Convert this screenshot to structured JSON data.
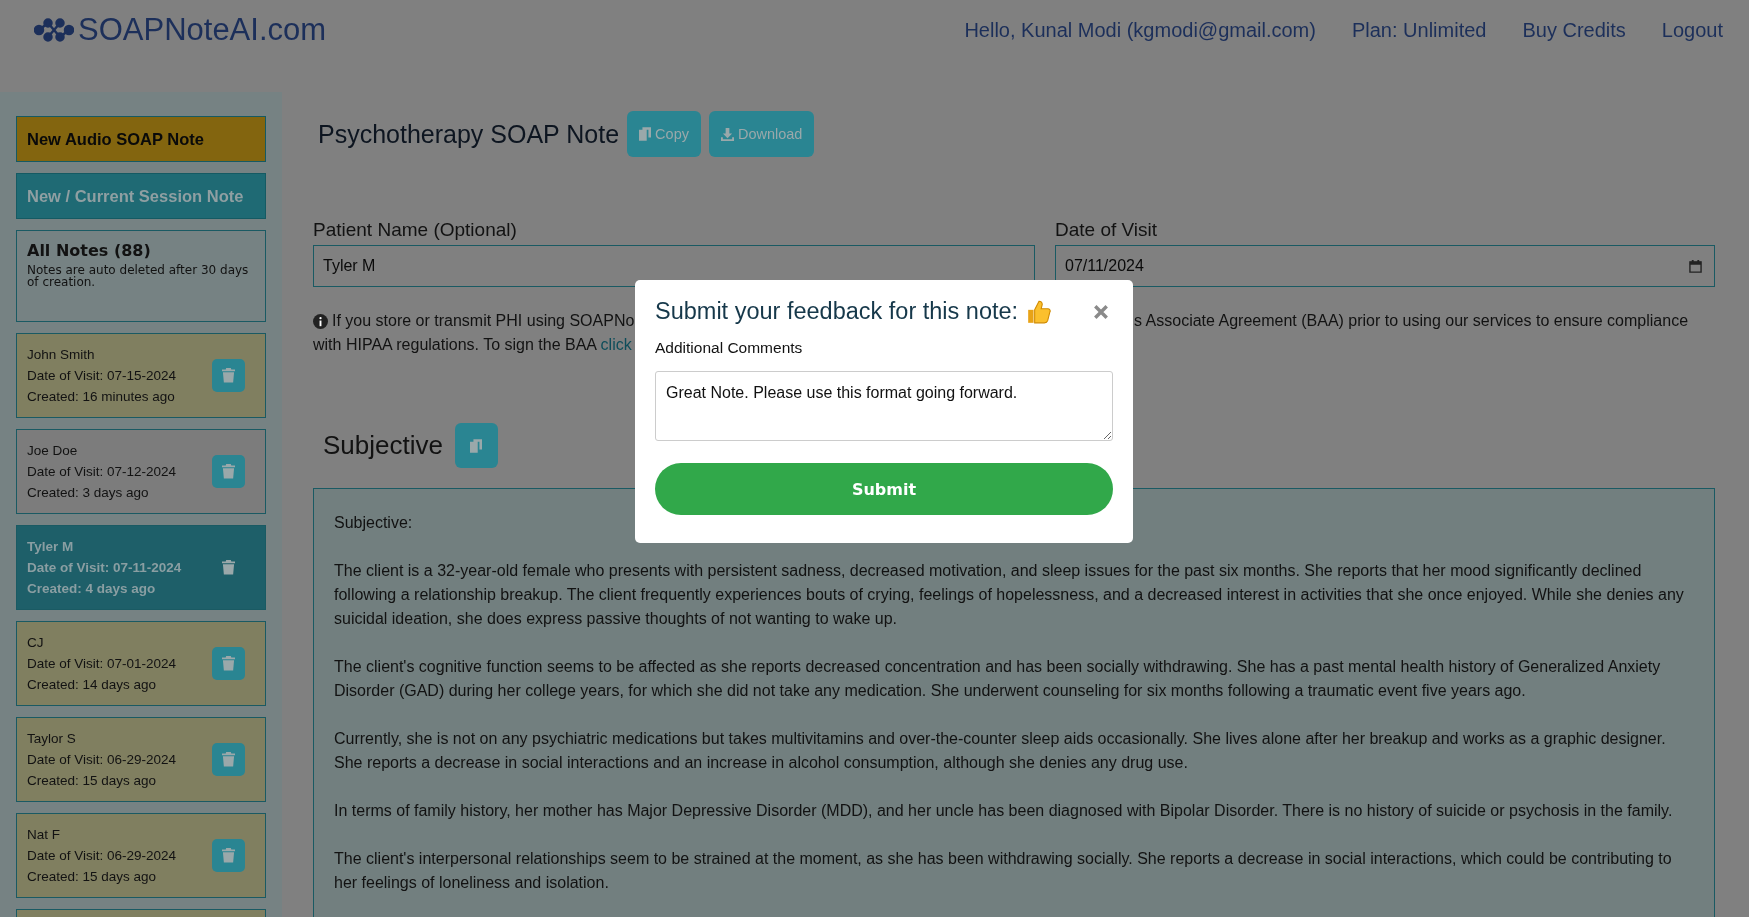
{
  "header": {
    "logo": "SOAPNoteAI.com",
    "nav": [
      {
        "label": "Hello, Kunal Modi (kgmodi@gmail.com)"
      },
      {
        "label": "Plan: Unlimited"
      },
      {
        "label": "Buy Credits"
      },
      {
        "label": "Logout"
      }
    ]
  },
  "sidebar": {
    "new_audio": "New Audio SOAP Note",
    "new_session": "New / Current Session Note",
    "all_notes": {
      "title": "All Notes (88)",
      "hint": "Notes are auto deleted after 30 days of creation."
    },
    "notes": [
      {
        "name": "John Smith",
        "date": "Date of Visit: 07-15-2024",
        "created": "Created: 16 minutes ago",
        "selected": false,
        "color": "#807f60"
      },
      {
        "name": "Joe Doe",
        "date": "Date of Visit: 07-12-2024",
        "created": "Created: 3 days ago",
        "selected": false,
        "color": "#7c7c7c"
      },
      {
        "name": "Tyler M",
        "date": "Date of Visit: 07-11-2024",
        "created": "Created: 4 days ago",
        "selected": true,
        "color": "#1e5f69"
      },
      {
        "name": "CJ",
        "date": "Date of Visit: 07-01-2024",
        "created": "Created: 14 days ago",
        "selected": false,
        "color": "#807f60"
      },
      {
        "name": "Taylor S",
        "date": "Date of Visit: 06-29-2024",
        "created": "Created: 15 days ago",
        "selected": false,
        "color": "#807f60"
      },
      {
        "name": "Nat F",
        "date": "Date of Visit: 06-29-2024",
        "created": "Created: 15 days ago",
        "selected": false,
        "color": "#807f60"
      }
    ]
  },
  "main": {
    "title": "Psychotherapy SOAP Note",
    "copy": "Copy",
    "download": "Download",
    "patient": {
      "label": "Patient Name (Optional)",
      "value": "Tyler M"
    },
    "date": {
      "label": "Date of Visit",
      "value": "07/11/2024"
    },
    "notice": {
      "line1_left": "If you store or transmit PHI using SOAPNo",
      "line1_right": "s Associate Agreement (BAA) prior to using our services to ensure compliance",
      "line2": "with HIPAA regulations. To sign the BAA",
      "link": "click"
    },
    "section": {
      "title": "Subjective",
      "paragraphs": [
        "Subjective:",
        "The client is a 32-year-old female who presents with persistent sadness, decreased motivation, and sleep issues for the past six months. She reports that her mood significantly declined following a relationship breakup. The client frequently experiences bouts of crying, feelings of hopelessness, and a decreased interest in activities that she once enjoyed. While she denies any suicidal ideation, she does express passive thoughts of not wanting to wake up.",
        "The client's cognitive function seems to be affected as she reports decreased concentration and has been socially withdrawing. She has a past mental health history of Generalized Anxiety Disorder (GAD) during her college years, for which she did not take any medication. She underwent counseling for six months following a traumatic event five years ago.",
        "Currently, she is not on any psychiatric medications but takes multivitamins and over-the-counter sleep aids occasionally. She lives alone after her breakup and works as a graphic designer. She reports a decrease in social interactions and an increase in alcohol consumption, although she denies any drug use.",
        "In terms of family history, her mother has Major Depressive Disorder (MDD), and her uncle has been diagnosed with Bipolar Disorder. There is no history of suicide or psychosis in the family.",
        "The client's interpersonal relationships seem to be strained at the moment, as she has been withdrawing socially. She reports a decrease in social interactions, which could be contributing to her feelings of loneliness and isolation."
      ]
    }
  },
  "modal": {
    "title": "Submit your feedback for this note:",
    "label": "Additional Comments",
    "value": "Great Note. Please use this format going forward.",
    "submit": "Submit"
  }
}
